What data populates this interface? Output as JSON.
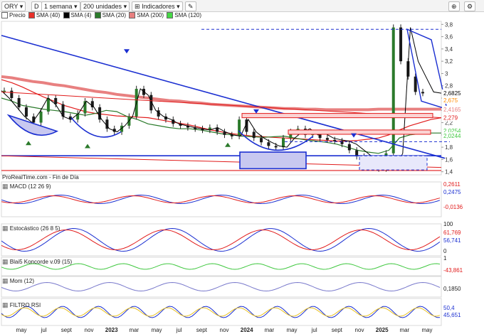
{
  "toolbar": {
    "symbol": "ORY",
    "d_label": "D",
    "period": "1 semana",
    "units": "200 unidades",
    "indicators": "Indicadores"
  },
  "legend": {
    "items": [
      {
        "label": "Precio",
        "color": "#ffffff"
      },
      {
        "label": "SMA (40)",
        "color": "#e8302a"
      },
      {
        "label": "SMA (4)",
        "color": "#000000"
      },
      {
        "label": "SMA (20)",
        "color": "#2a7a2a"
      },
      {
        "label": "SMA (200)",
        "color": "#e88080"
      },
      {
        "label": "SMA (120)",
        "color": "#46d846"
      }
    ]
  },
  "source_text": "ProRealTime.com - Fin de Día",
  "colors": {
    "up": "#2b7a2b",
    "down": "#1a1a1a",
    "blue": "#1b2fd1",
    "red": "#e11b1b",
    "pink": "#e88080",
    "green": "#40c840"
  },
  "chart_data": {
    "type": "line",
    "title": "ORY",
    "y_ticks": [
      "3,8",
      "3,6",
      "3,4",
      "3,2",
      "3",
      "2,8",
      "2,6",
      "2,4",
      "2,2",
      "2",
      "1,8",
      "1,6",
      "1,4"
    ],
    "ylim": [
      1.35,
      3.85
    ],
    "value_labels": [
      {
        "text": "2,6825",
        "color": "#000000",
        "y": 2.6825
      },
      {
        "text": "2,675",
        "color": "#ff8c00",
        "y": 2.565
      },
      {
        "text": "2,4165",
        "color": "#e88080",
        "y": 2.4165
      },
      {
        "text": "2,279",
        "color": "#e11b1b",
        "y": 2.279
      },
      {
        "text": "2,0254",
        "color": "#40c840",
        "y": 2.07
      },
      {
        "text": "2,0244",
        "color": "#40c840",
        "y": 1.985
      }
    ],
    "x_labels": [
      "may",
      "jul",
      "sept",
      "nov",
      "2023",
      "mar",
      "may",
      "jul",
      "sept",
      "nov",
      "2024",
      "mar",
      "may",
      "jul",
      "sept",
      "nov",
      "2025",
      "mar",
      "may"
    ],
    "price_series": [
      2.72,
      2.6,
      2.45,
      2.3,
      2.2,
      2.38,
      2.6,
      2.5,
      2.3,
      2.25,
      2.35,
      2.55,
      2.45,
      2.25,
      2.1,
      2.05,
      2.15,
      2.3,
      2.75,
      2.65,
      2.4,
      2.3,
      2.25,
      2.18,
      2.15,
      2.12,
      2.1,
      2.08,
      2.12,
      2.05,
      2.0,
      1.98,
      2.25,
      2.05,
      1.95,
      1.88,
      1.82,
      1.8,
      1.95,
      2.05,
      2.1,
      2.0,
      2.02,
      1.95,
      1.92,
      1.9,
      1.85,
      1.75,
      1.65,
      1.55,
      1.5,
      1.45,
      1.7,
      3.75,
      3.2,
      2.95,
      2.7,
      2.68
    ],
    "sma_200": [
      2.95,
      2.93,
      2.9,
      2.87,
      2.85,
      2.82,
      2.8,
      2.77,
      2.74,
      2.71,
      2.69,
      2.66,
      2.64,
      2.62,
      2.6,
      2.58,
      2.56,
      2.55,
      2.53,
      2.52,
      2.5,
      2.49,
      2.48,
      2.47,
      2.46,
      2.45,
      2.44,
      2.43,
      2.43,
      2.42,
      2.42,
      2.41,
      2.41,
      2.41,
      2.41,
      2.41,
      2.42,
      2.42,
      2.42,
      2.42,
      2.42,
      2.42,
      2.42
    ],
    "sma_40": [
      2.9,
      2.85,
      2.78,
      2.7,
      2.62,
      2.55,
      2.48,
      2.43,
      2.38,
      2.35,
      2.33,
      2.31,
      2.3,
      2.29,
      2.28,
      2.25,
      2.22,
      2.19,
      2.16,
      2.12,
      2.08,
      2.05,
      2.02,
      2.0,
      1.98,
      1.97,
      1.96,
      1.95,
      1.94,
      1.93,
      1.92,
      1.91,
      1.9,
      1.9,
      1.91,
      1.93,
      1.95,
      2.0,
      2.08,
      2.15,
      2.2,
      2.25,
      2.28
    ],
    "sma_20": [
      2.6,
      2.55,
      2.48,
      2.45,
      2.42,
      2.4,
      2.38,
      2.35,
      2.32,
      2.35,
      2.4,
      2.38,
      2.3,
      2.25,
      2.18,
      2.15,
      2.12,
      2.1,
      2.1,
      2.08,
      2.05,
      2.02,
      2.0,
      1.98,
      1.97,
      1.96,
      1.97,
      1.98,
      1.95,
      1.92,
      1.9,
      1.88,
      1.85,
      1.8,
      1.75,
      1.72,
      1.7,
      1.75,
      1.95,
      2.0,
      2.02,
      2.03,
      2.03
    ],
    "macd_labels": [
      "0,2611",
      "0,2475",
      "-0,0136"
    ],
    "stoch_labels": [
      "100",
      "61,769",
      "56,741",
      "0"
    ],
    "koncorde_labels": [
      "1",
      "-43,861"
    ],
    "mom_labels": [
      "0,1850"
    ],
    "rsi_labels": [
      "50,4",
      "45,651"
    ]
  },
  "panels": [
    {
      "name": "MACD (12 26 9)"
    },
    {
      "name": "Estocástico (26 8 5)"
    },
    {
      "name": "Blai5 Koncorde v.09 (15)"
    },
    {
      "name": "Mom (12)"
    },
    {
      "name": "FILTRO RSI"
    }
  ]
}
